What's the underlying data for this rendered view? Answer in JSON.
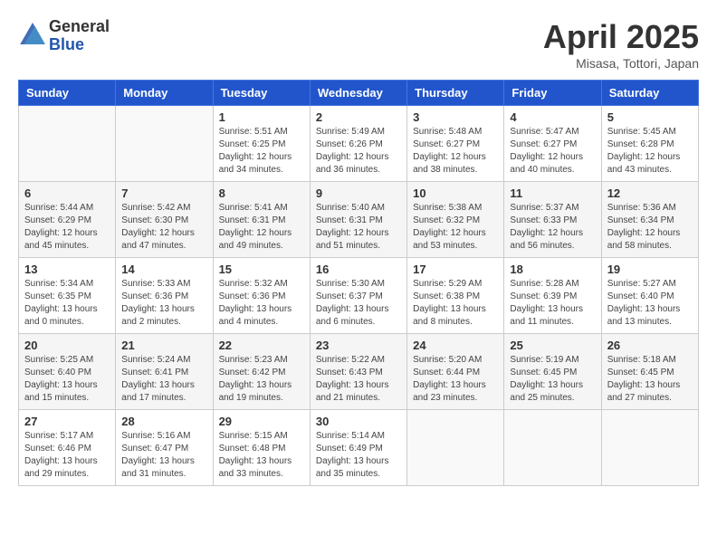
{
  "header": {
    "logo": {
      "general": "General",
      "blue": "Blue"
    },
    "title": "April 2025",
    "location": "Misasa, Tottori, Japan"
  },
  "weekdays": [
    "Sunday",
    "Monday",
    "Tuesday",
    "Wednesday",
    "Thursday",
    "Friday",
    "Saturday"
  ],
  "weeks": [
    [
      {
        "day": "",
        "sunrise": "",
        "sunset": "",
        "daylight": ""
      },
      {
        "day": "",
        "sunrise": "",
        "sunset": "",
        "daylight": ""
      },
      {
        "day": "1",
        "sunrise": "Sunrise: 5:51 AM",
        "sunset": "Sunset: 6:25 PM",
        "daylight": "Daylight: 12 hours and 34 minutes."
      },
      {
        "day": "2",
        "sunrise": "Sunrise: 5:49 AM",
        "sunset": "Sunset: 6:26 PM",
        "daylight": "Daylight: 12 hours and 36 minutes."
      },
      {
        "day": "3",
        "sunrise": "Sunrise: 5:48 AM",
        "sunset": "Sunset: 6:27 PM",
        "daylight": "Daylight: 12 hours and 38 minutes."
      },
      {
        "day": "4",
        "sunrise": "Sunrise: 5:47 AM",
        "sunset": "Sunset: 6:27 PM",
        "daylight": "Daylight: 12 hours and 40 minutes."
      },
      {
        "day": "5",
        "sunrise": "Sunrise: 5:45 AM",
        "sunset": "Sunset: 6:28 PM",
        "daylight": "Daylight: 12 hours and 43 minutes."
      }
    ],
    [
      {
        "day": "6",
        "sunrise": "Sunrise: 5:44 AM",
        "sunset": "Sunset: 6:29 PM",
        "daylight": "Daylight: 12 hours and 45 minutes."
      },
      {
        "day": "7",
        "sunrise": "Sunrise: 5:42 AM",
        "sunset": "Sunset: 6:30 PM",
        "daylight": "Daylight: 12 hours and 47 minutes."
      },
      {
        "day": "8",
        "sunrise": "Sunrise: 5:41 AM",
        "sunset": "Sunset: 6:31 PM",
        "daylight": "Daylight: 12 hours and 49 minutes."
      },
      {
        "day": "9",
        "sunrise": "Sunrise: 5:40 AM",
        "sunset": "Sunset: 6:31 PM",
        "daylight": "Daylight: 12 hours and 51 minutes."
      },
      {
        "day": "10",
        "sunrise": "Sunrise: 5:38 AM",
        "sunset": "Sunset: 6:32 PM",
        "daylight": "Daylight: 12 hours and 53 minutes."
      },
      {
        "day": "11",
        "sunrise": "Sunrise: 5:37 AM",
        "sunset": "Sunset: 6:33 PM",
        "daylight": "Daylight: 12 hours and 56 minutes."
      },
      {
        "day": "12",
        "sunrise": "Sunrise: 5:36 AM",
        "sunset": "Sunset: 6:34 PM",
        "daylight": "Daylight: 12 hours and 58 minutes."
      }
    ],
    [
      {
        "day": "13",
        "sunrise": "Sunrise: 5:34 AM",
        "sunset": "Sunset: 6:35 PM",
        "daylight": "Daylight: 13 hours and 0 minutes."
      },
      {
        "day": "14",
        "sunrise": "Sunrise: 5:33 AM",
        "sunset": "Sunset: 6:36 PM",
        "daylight": "Daylight: 13 hours and 2 minutes."
      },
      {
        "day": "15",
        "sunrise": "Sunrise: 5:32 AM",
        "sunset": "Sunset: 6:36 PM",
        "daylight": "Daylight: 13 hours and 4 minutes."
      },
      {
        "day": "16",
        "sunrise": "Sunrise: 5:30 AM",
        "sunset": "Sunset: 6:37 PM",
        "daylight": "Daylight: 13 hours and 6 minutes."
      },
      {
        "day": "17",
        "sunrise": "Sunrise: 5:29 AM",
        "sunset": "Sunset: 6:38 PM",
        "daylight": "Daylight: 13 hours and 8 minutes."
      },
      {
        "day": "18",
        "sunrise": "Sunrise: 5:28 AM",
        "sunset": "Sunset: 6:39 PM",
        "daylight": "Daylight: 13 hours and 11 minutes."
      },
      {
        "day": "19",
        "sunrise": "Sunrise: 5:27 AM",
        "sunset": "Sunset: 6:40 PM",
        "daylight": "Daylight: 13 hours and 13 minutes."
      }
    ],
    [
      {
        "day": "20",
        "sunrise": "Sunrise: 5:25 AM",
        "sunset": "Sunset: 6:40 PM",
        "daylight": "Daylight: 13 hours and 15 minutes."
      },
      {
        "day": "21",
        "sunrise": "Sunrise: 5:24 AM",
        "sunset": "Sunset: 6:41 PM",
        "daylight": "Daylight: 13 hours and 17 minutes."
      },
      {
        "day": "22",
        "sunrise": "Sunrise: 5:23 AM",
        "sunset": "Sunset: 6:42 PM",
        "daylight": "Daylight: 13 hours and 19 minutes."
      },
      {
        "day": "23",
        "sunrise": "Sunrise: 5:22 AM",
        "sunset": "Sunset: 6:43 PM",
        "daylight": "Daylight: 13 hours and 21 minutes."
      },
      {
        "day": "24",
        "sunrise": "Sunrise: 5:20 AM",
        "sunset": "Sunset: 6:44 PM",
        "daylight": "Daylight: 13 hours and 23 minutes."
      },
      {
        "day": "25",
        "sunrise": "Sunrise: 5:19 AM",
        "sunset": "Sunset: 6:45 PM",
        "daylight": "Daylight: 13 hours and 25 minutes."
      },
      {
        "day": "26",
        "sunrise": "Sunrise: 5:18 AM",
        "sunset": "Sunset: 6:45 PM",
        "daylight": "Daylight: 13 hours and 27 minutes."
      }
    ],
    [
      {
        "day": "27",
        "sunrise": "Sunrise: 5:17 AM",
        "sunset": "Sunset: 6:46 PM",
        "daylight": "Daylight: 13 hours and 29 minutes."
      },
      {
        "day": "28",
        "sunrise": "Sunrise: 5:16 AM",
        "sunset": "Sunset: 6:47 PM",
        "daylight": "Daylight: 13 hours and 31 minutes."
      },
      {
        "day": "29",
        "sunrise": "Sunrise: 5:15 AM",
        "sunset": "Sunset: 6:48 PM",
        "daylight": "Daylight: 13 hours and 33 minutes."
      },
      {
        "day": "30",
        "sunrise": "Sunrise: 5:14 AM",
        "sunset": "Sunset: 6:49 PM",
        "daylight": "Daylight: 13 hours and 35 minutes."
      },
      {
        "day": "",
        "sunrise": "",
        "sunset": "",
        "daylight": ""
      },
      {
        "day": "",
        "sunrise": "",
        "sunset": "",
        "daylight": ""
      },
      {
        "day": "",
        "sunrise": "",
        "sunset": "",
        "daylight": ""
      }
    ]
  ]
}
